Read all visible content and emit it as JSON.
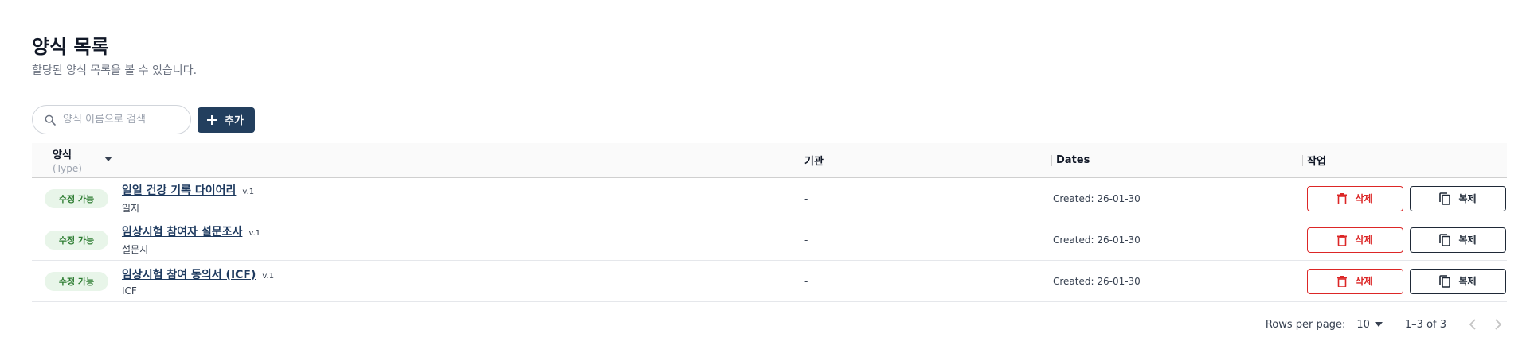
{
  "header": {
    "title": "양식 목록",
    "subtitle": "할당된 양식 목록을 볼 수 있습니다."
  },
  "toolbar": {
    "search_placeholder": "양식 이름으로 검색",
    "add_label": "추가"
  },
  "table": {
    "columns": {
      "type": "양식",
      "type_sub": "(Type)",
      "org": "기관",
      "dates": "Dates",
      "actions": "작업"
    },
    "rows": [
      {
        "status": "수정 가능",
        "name": "일일 건강 기록 다이어리",
        "version": "v.1",
        "type": "일지",
        "org": "-",
        "created": "Created: 26-01-30"
      },
      {
        "status": "수정 가능",
        "name": "임상시험 참여자 설문조사",
        "version": "v.1",
        "type": "설문지",
        "org": "-",
        "created": "Created: 26-01-30"
      },
      {
        "status": "수정 가능",
        "name": "임상시험 참여 동의서 (ICF)",
        "version": "v.1",
        "type": "ICF",
        "org": "-",
        "created": "Created: 26-01-30"
      }
    ],
    "delete_label": "삭제",
    "copy_label": "복제"
  },
  "pagination": {
    "rows_per_page_label": "Rows per page:",
    "rows_per_page": "10",
    "range": "1–3 of 3"
  },
  "colors": {
    "primary": "#233f5e",
    "danger": "#dc2626",
    "badge_bg": "#e8f5e9",
    "badge_text": "#2e7d32"
  },
  "icons": [
    "search-icon",
    "plus-icon",
    "sort-desc-icon",
    "trash-icon",
    "copy-icon",
    "dropdown-icon",
    "chevron-left-icon",
    "chevron-right-icon"
  ]
}
